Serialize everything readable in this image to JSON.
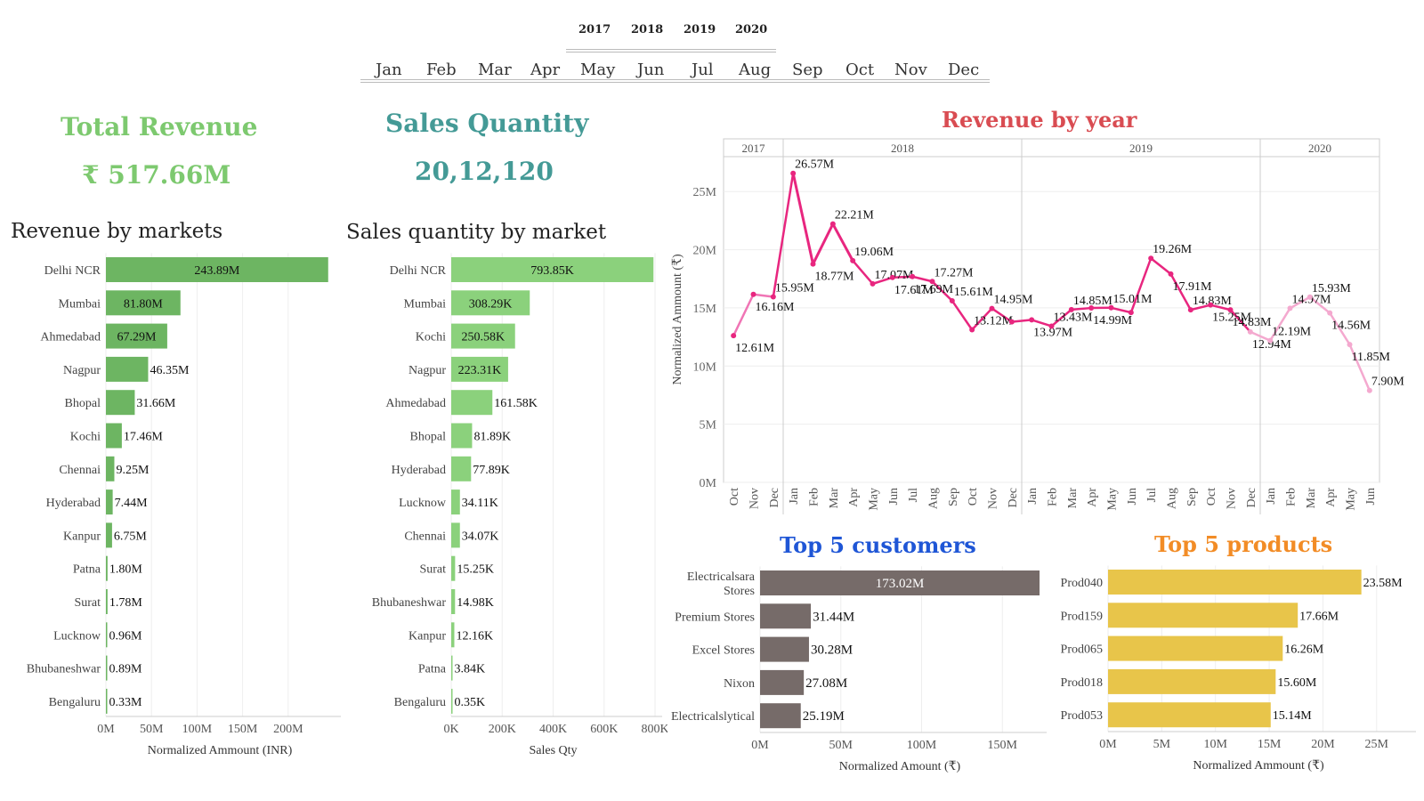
{
  "filters": {
    "years": [
      "2017",
      "2018",
      "2019",
      "2020"
    ],
    "months": [
      "Jan",
      "Feb",
      "Mar",
      "Apr",
      "May",
      "Jun",
      "Jul",
      "Aug",
      "Sep",
      "Oct",
      "Nov",
      "Dec"
    ]
  },
  "kpis": {
    "revenue_title": "Total Revenue",
    "revenue_value": "₹ 517.66M",
    "quantity_title": "Sales Quantity",
    "quantity_value": "20,12,120"
  },
  "colors": {
    "revenue_title": "#7dc96f",
    "quantity_title": "#449a96",
    "rev_markets_bar": "#6db562",
    "qty_markets_bar": "#8bd17c",
    "line": "#e8267f",
    "line_light": "#f4a9cf",
    "line_title": "#d94c52",
    "customers_title": "#1f56d6",
    "customers_bar": "#766b69",
    "products_title": "#f28c26",
    "products_bar": "#e8c54a"
  },
  "chart_data": [
    {
      "id": "revenue_by_markets",
      "type": "bar",
      "orientation": "horizontal",
      "title": "Revenue by markets",
      "xlabel": "Normalized Ammount (INR)",
      "ylabel": "",
      "categories": [
        "Delhi NCR",
        "Mumbai",
        "Ahmedabad",
        "Nagpur",
        "Bhopal",
        "Kochi",
        "Chennai",
        "Hyderabad",
        "Kanpur",
        "Patna",
        "Surat",
        "Lucknow",
        "Bhubaneshwar",
        "Bengaluru"
      ],
      "values": [
        243.89,
        81.8,
        67.29,
        46.35,
        31.66,
        17.46,
        9.25,
        7.44,
        6.75,
        1.8,
        1.78,
        0.96,
        0.89,
        0.33
      ],
      "labels": [
        "243.89M",
        "81.80M",
        "67.29M",
        "46.35M",
        "31.66M",
        "17.46M",
        "9.25M",
        "7.44M",
        "6.75M",
        "1.80M",
        "1.78M",
        "0.96M",
        "0.89M",
        "0.33M"
      ],
      "unit": "M",
      "xlim": [
        0,
        250
      ],
      "xticks": [
        "0M",
        "50M",
        "100M",
        "150M",
        "200M"
      ]
    },
    {
      "id": "sales_qty_by_market",
      "type": "bar",
      "orientation": "horizontal",
      "title": "Sales quantity by market",
      "xlabel": "Sales Qty",
      "ylabel": "",
      "categories": [
        "Delhi NCR",
        "Mumbai",
        "Kochi",
        "Nagpur",
        "Ahmedabad",
        "Bhopal",
        "Hyderabad",
        "Lucknow",
        "Chennai",
        "Surat",
        "Bhubaneshwar",
        "Kanpur",
        "Patna",
        "Bengaluru"
      ],
      "values": [
        793.85,
        308.29,
        250.58,
        223.31,
        161.58,
        81.89,
        77.89,
        34.11,
        34.07,
        15.25,
        14.98,
        12.16,
        3.84,
        0.35
      ],
      "labels": [
        "793.85K",
        "308.29K",
        "250.58K",
        "223.31K",
        "161.58K",
        "81.89K",
        "77.89K",
        "34.11K",
        "34.07K",
        "15.25K",
        "14.98K",
        "12.16K",
        "3.84K",
        "0.35K"
      ],
      "unit": "K",
      "xlim": [
        0,
        800
      ],
      "xticks": [
        "0K",
        "200K",
        "400K",
        "600K",
        "800K"
      ]
    },
    {
      "id": "revenue_by_year",
      "type": "line",
      "title": "Revenue by year",
      "xlabel": "",
      "ylabel": "Normalized Ammount (₹)",
      "ylim": [
        0,
        28
      ],
      "yticks": [
        "0M",
        "5M",
        "10M",
        "15M",
        "20M",
        "25M"
      ],
      "panels": [
        {
          "year": "2017",
          "months": [
            "Oct",
            "Nov",
            "Dec"
          ]
        },
        {
          "year": "2018",
          "months": [
            "Jan",
            "Feb",
            "Mar",
            "Apr",
            "May",
            "Jun",
            "Jul",
            "Aug",
            "Sep",
            "Oct",
            "Nov",
            "Dec"
          ]
        },
        {
          "year": "2019",
          "months": [
            "Jan",
            "Feb",
            "Mar",
            "Apr",
            "May",
            "Jun",
            "Jul",
            "Aug",
            "Sep",
            "Oct",
            "Nov",
            "Dec"
          ]
        },
        {
          "year": "2020",
          "months": [
            "Jan",
            "Feb",
            "Mar",
            "Apr",
            "May",
            "Jun"
          ]
        }
      ],
      "values": [
        12.61,
        16.16,
        15.95,
        26.57,
        18.77,
        22.21,
        19.06,
        17.07,
        17.61,
        17.69,
        17.27,
        15.61,
        13.12,
        14.95,
        13.8,
        13.97,
        13.43,
        14.85,
        14.99,
        15.01,
        14.6,
        19.26,
        17.91,
        14.83,
        15.25,
        14.83,
        12.94,
        12.19,
        14.97,
        15.93,
        14.56,
        11.85,
        7.9
      ],
      "labels": [
        "12.61M",
        "16.16M",
        "15.95M",
        "26.57M",
        "18.77M",
        "22.21M",
        "19.06M",
        "17.07M",
        "17.61M",
        "17.69M",
        "17.27M",
        "15.61M",
        "13.12M",
        "14.95M",
        "",
        "13.97M",
        "13.43M",
        "14.85M",
        "14.99M",
        "15.01M",
        "",
        "19.26M",
        "17.91M",
        "14.83M",
        "15.25M",
        "14.83M",
        "12.94M",
        "12.19M",
        "14.97M",
        "15.93M",
        "14.56M",
        "11.85M",
        "7.90M"
      ]
    },
    {
      "id": "top5_customers",
      "type": "bar",
      "orientation": "horizontal",
      "title": "Top 5 customers",
      "xlabel": "Normalized Amount (₹)",
      "ylabel": "",
      "categories": [
        "Electricalsara Stores",
        "Premium Stores",
        "Excel Stores",
        "Nixon",
        "Electricalslytical"
      ],
      "values": [
        173.02,
        31.44,
        30.28,
        27.08,
        25.19
      ],
      "labels": [
        "173.02M",
        "31.44M",
        "30.28M",
        "27.08M",
        "25.19M"
      ],
      "unit": "M",
      "xlim": [
        0,
        173
      ],
      "xticks": [
        "0M",
        "50M",
        "100M",
        "150M"
      ]
    },
    {
      "id": "top5_products",
      "type": "bar",
      "orientation": "horizontal",
      "title": "Top 5 products",
      "xlabel": "Normalized Ammount (₹)",
      "ylabel": "",
      "categories": [
        "Prod040",
        "Prod159",
        "Prod065",
        "Prod018",
        "Prod053"
      ],
      "values": [
        23.58,
        17.66,
        16.26,
        15.6,
        15.14
      ],
      "labels": [
        "23.58M",
        "17.66M",
        "16.26M",
        "15.60M",
        "15.14M"
      ],
      "unit": "M",
      "xlim": [
        0,
        28
      ],
      "xticks": [
        "0M",
        "5M",
        "10M",
        "15M",
        "20M",
        "25M"
      ]
    }
  ]
}
